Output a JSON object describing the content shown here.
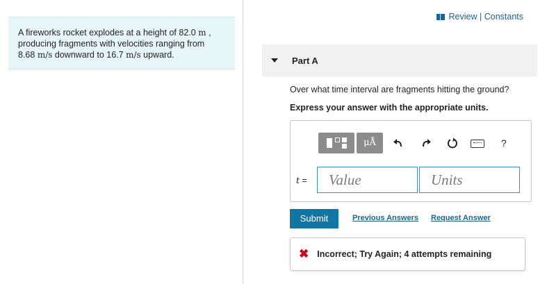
{
  "problem": {
    "line1_pre": "A fireworks rocket explodes at a height of 82.0",
    "line1_unit": "m",
    "line1_post": ",",
    "line2": "producing fragments with velocities ranging from",
    "line3_value1": "8.68",
    "line3_unit1": "m/s",
    "line3_mid": "downward to 16.7",
    "line3_unit2": "m/s",
    "line3_post": "upward."
  },
  "header": {
    "review_constants": "Review | Constants",
    "icon": "book-icon"
  },
  "part": {
    "title": "Part A",
    "question": "Over what time interval are fragments hitting the ground?",
    "instruction": "Express your answer with the appropriate units."
  },
  "toolbar": {
    "units_label": "μÅ",
    "help_label": "?",
    "icons": [
      "templates-icon",
      "units-icon",
      "undo-icon",
      "redo-icon",
      "reset-icon",
      "keyboard-icon",
      "help-icon"
    ]
  },
  "answer": {
    "variable": "t",
    "equals": "=",
    "value_placeholder": "Value",
    "units_placeholder": "Units"
  },
  "actions": {
    "submit": "Submit",
    "previous_answers": "Previous Answers",
    "request_answer": "Request Answer"
  },
  "feedback": {
    "icon": "x-mark-icon",
    "text": "Incorrect; Try Again; 4 attempts remaining",
    "color": "#d0021b"
  },
  "colors": {
    "accent": "#1077a5",
    "link": "#1a6496",
    "problem_bg": "#e6f6f9",
    "input_border": "#3a8fc4"
  }
}
